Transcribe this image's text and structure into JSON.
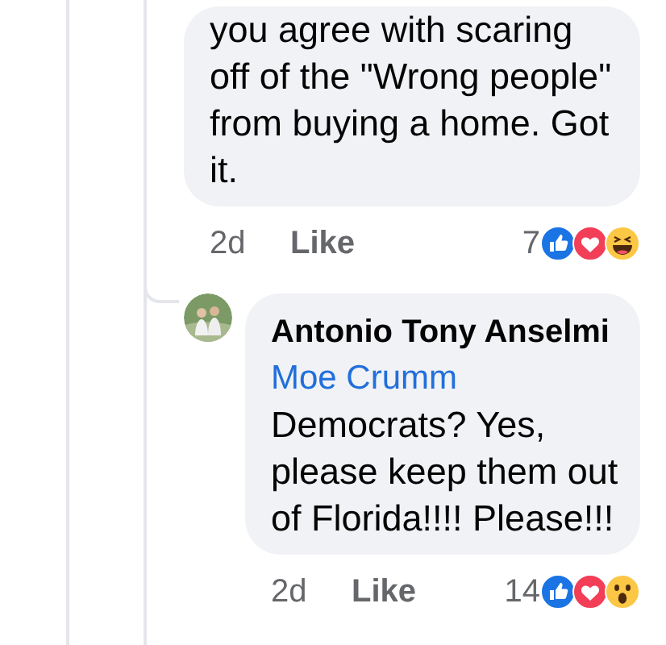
{
  "comments": [
    {
      "text": "you agree with scaring off of the \"Wrong people\" from buying a home. Got it.",
      "time": "2d",
      "like_label": "Like",
      "reaction_count": "7",
      "reactions": [
        {
          "kind": "like"
        },
        {
          "kind": "love"
        },
        {
          "kind": "haha"
        }
      ]
    },
    {
      "author": "Antonio Tony Anselmi",
      "mention": "Moe Crumm",
      "text": "Democrats?  Yes, please keep them out of Florida!!!! Please!!!",
      "time": "2d",
      "like_label": "Like",
      "reaction_count": "14",
      "reactions": [
        {
          "kind": "like"
        },
        {
          "kind": "love"
        },
        {
          "kind": "wow"
        }
      ]
    }
  ]
}
